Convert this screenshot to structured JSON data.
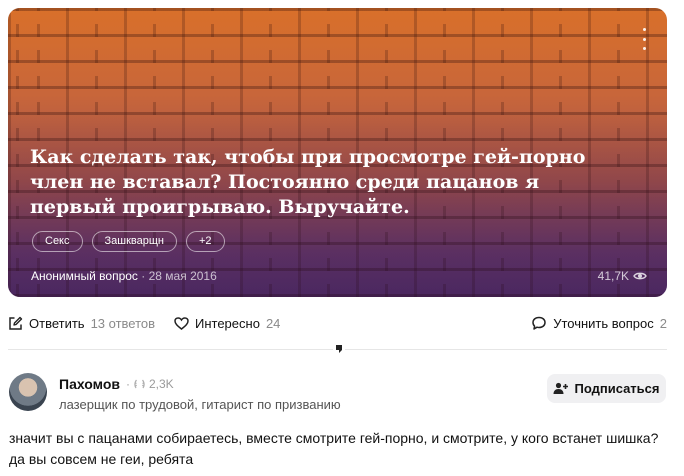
{
  "question": {
    "title": "Как сделать так, чтобы при просмотре гей-порно член не вставал? Постоянно среди пацанов я первый проигрываю. Выручайте.",
    "tags": [
      "Секс",
      "Зашкварщн",
      "+2"
    ],
    "author": "Анонимный вопрос",
    "separator": "·",
    "date": "28 мая 2016",
    "views": "41,7K",
    "menu_icon": "more-vertical-icon"
  },
  "actions": {
    "answer_label": "Ответить",
    "answer_count": "13 ответов",
    "interest_label": "Интересно",
    "interest_count": "24",
    "clarify_label": "Уточнить вопрос",
    "clarify_count": "2"
  },
  "answer": {
    "author_name": "Пахомов",
    "karma_separator": "·",
    "karma": "2,3K",
    "author_description": "лазерщик по трудовой, гитарист по призванию",
    "subscribe_label": "Подписаться",
    "text": "значит вы с пацанами собираетесь, вместе смотрите гей-порно, и смотрите, у кого встанет шишка? да вы совсем не геи, ребята"
  },
  "colors": {
    "card_top": "#d9702a",
    "card_bottom": "#5d3779",
    "muted_text": "#8a8a8a",
    "subscribe_bg": "#f0f0f2"
  }
}
